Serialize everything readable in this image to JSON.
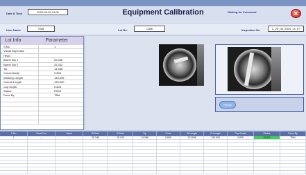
{
  "header": {
    "datetime_label": "Date & Time",
    "datetime_value": "2023-05-20 14:00",
    "title": "Equipment Calibration",
    "status": "Waiting for Command",
    "close_glyph": "✕"
  },
  "row2": {
    "user_label": "User Name",
    "user_value": "TBM",
    "lot_label": "Lot No.",
    "lot_value": "Calib",
    "insp_label": "Inspection No",
    "insp_value": "C_20_06_2024_14_07"
  },
  "lot_info": {
    "header_left": "Lot Info",
    "header_right": "Parameter",
    "rows": [
      {
        "k": "S.No",
        "v": "1"
      },
      {
        "k": "Visual Inspection",
        "v": ""
      },
      {
        "k": "Head",
        "v": ""
      },
      {
        "k": "Barrel Dia 1",
        "v": "25.346"
      },
      {
        "k": "Barrel Dia 2",
        "v": "25.342"
      },
      {
        "k": "Tip",
        "v": "14.068"
      },
      {
        "k": "Concentricity",
        "v": "0.806"
      },
      {
        "k": "Working Length",
        "v": "133.595"
      },
      {
        "k": "Overall Length",
        "v": "133.600"
      },
      {
        "k": "Cup Depth",
        "v": "0.805"
      },
      {
        "k": "Status",
        "v": "PASS"
      },
      {
        "k": "Done By",
        "v": "TBM"
      },
      {
        "k": "",
        "v": ""
      },
      {
        "k": "",
        "v": ""
      },
      {
        "k": "",
        "v": ""
      },
      {
        "k": "",
        "v": ""
      },
      {
        "k": "",
        "v": ""
      },
      {
        "k": "",
        "v": ""
      }
    ]
  },
  "info_pill": "Result",
  "table": {
    "headers": [
      "S.No",
      "Visual Ins",
      "Head",
      "B.Dia1",
      "B.Dia2",
      "Tip",
      "Conc",
      "W.Length",
      "O.Length",
      "Cup Depth",
      "Status",
      "Done By"
    ],
    "rows": [
      [
        "1",
        "---",
        "---",
        "25.346",
        "25.342",
        "14.068",
        "0.806",
        "133.595",
        "133.600",
        "0.805",
        "PASS",
        "TBM"
      ]
    ]
  },
  "colors": {
    "accent": "#5a6fa8",
    "pass": "#3dd24b",
    "close": "#c0201a"
  }
}
